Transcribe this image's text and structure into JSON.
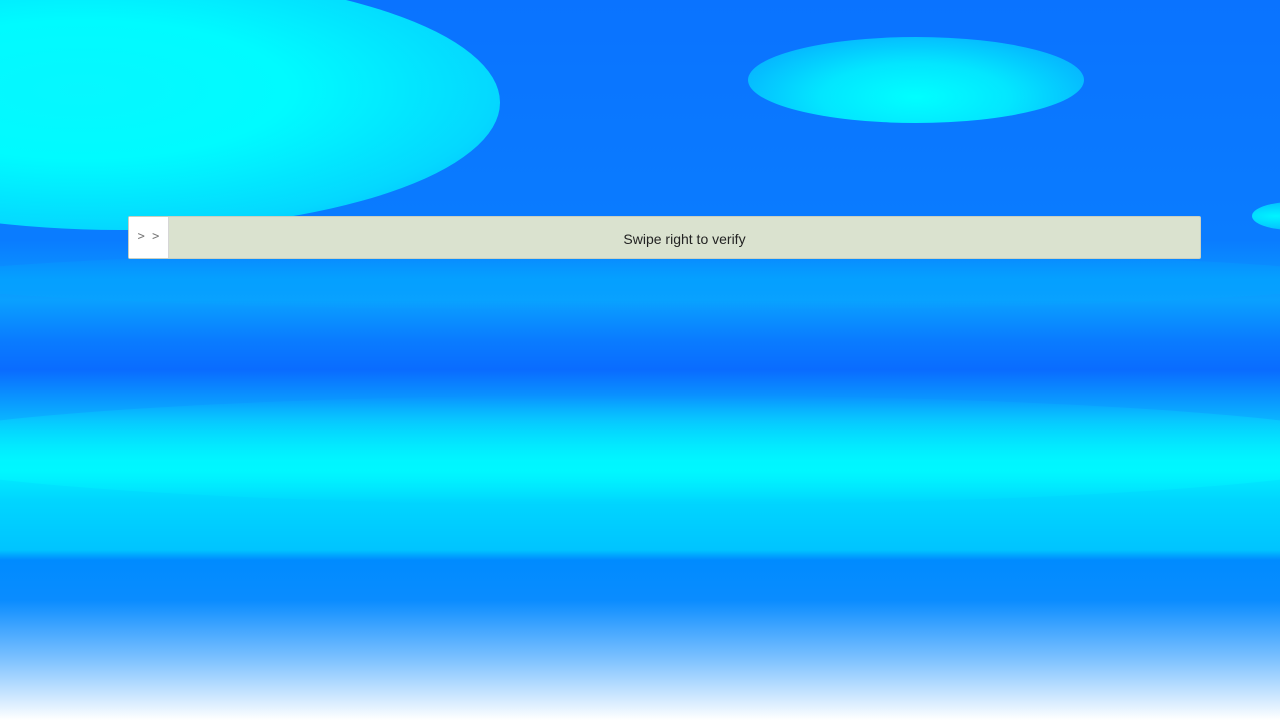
{
  "verify_slider": {
    "handle_icon": "double-chevron-right-icon",
    "handle_glyph": "> >",
    "prompt_text": "Swipe right to verify",
    "progress": 0
  },
  "colors": {
    "track": "#dae2cf",
    "handle": "#ffffff",
    "background_primary": "#0a78ff",
    "background_accent": "#00ffff"
  }
}
